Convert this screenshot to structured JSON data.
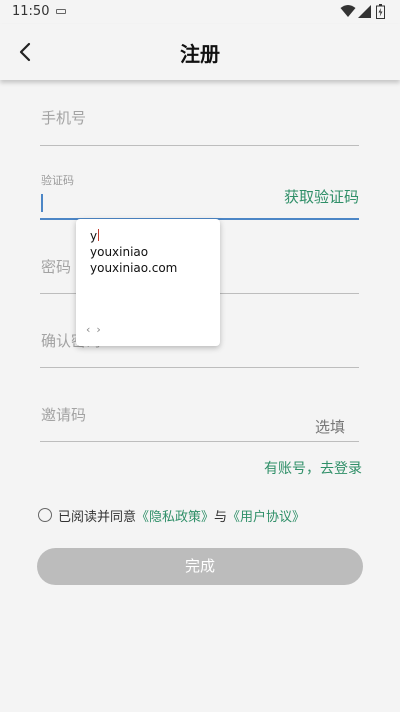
{
  "status_bar": {
    "time": "11:50",
    "icons": [
      "notification-icon",
      "wifi-icon",
      "signal-icon",
      "battery-icon"
    ]
  },
  "header": {
    "title": "注册",
    "back_icon": "arrow-left-icon"
  },
  "form": {
    "phone": {
      "placeholder": "手机号"
    },
    "code": {
      "label": "验证码",
      "action": "获取验证码"
    },
    "password": {
      "placeholder": "密码"
    },
    "confirm_password": {
      "placeholder": "确认密码"
    },
    "invite": {
      "placeholder": "邀请码",
      "hint": "选填"
    }
  },
  "login_link": "有账号，去登录",
  "agreement": {
    "prefix": "已阅读并同意",
    "privacy": "《隐私政策》",
    "and": "与",
    "terms": "《用户协议》"
  },
  "submit_label": "完成",
  "autocomplete": {
    "typed": "y",
    "items": [
      "youxiniao",
      "youxiniao.com"
    ],
    "nav": [
      "‹",
      "›"
    ]
  },
  "colors": {
    "accent": "#2f8f68",
    "focus": "#4c86c6",
    "button_disabled": "#bcbcbc",
    "background": "#f4f4f4"
  }
}
